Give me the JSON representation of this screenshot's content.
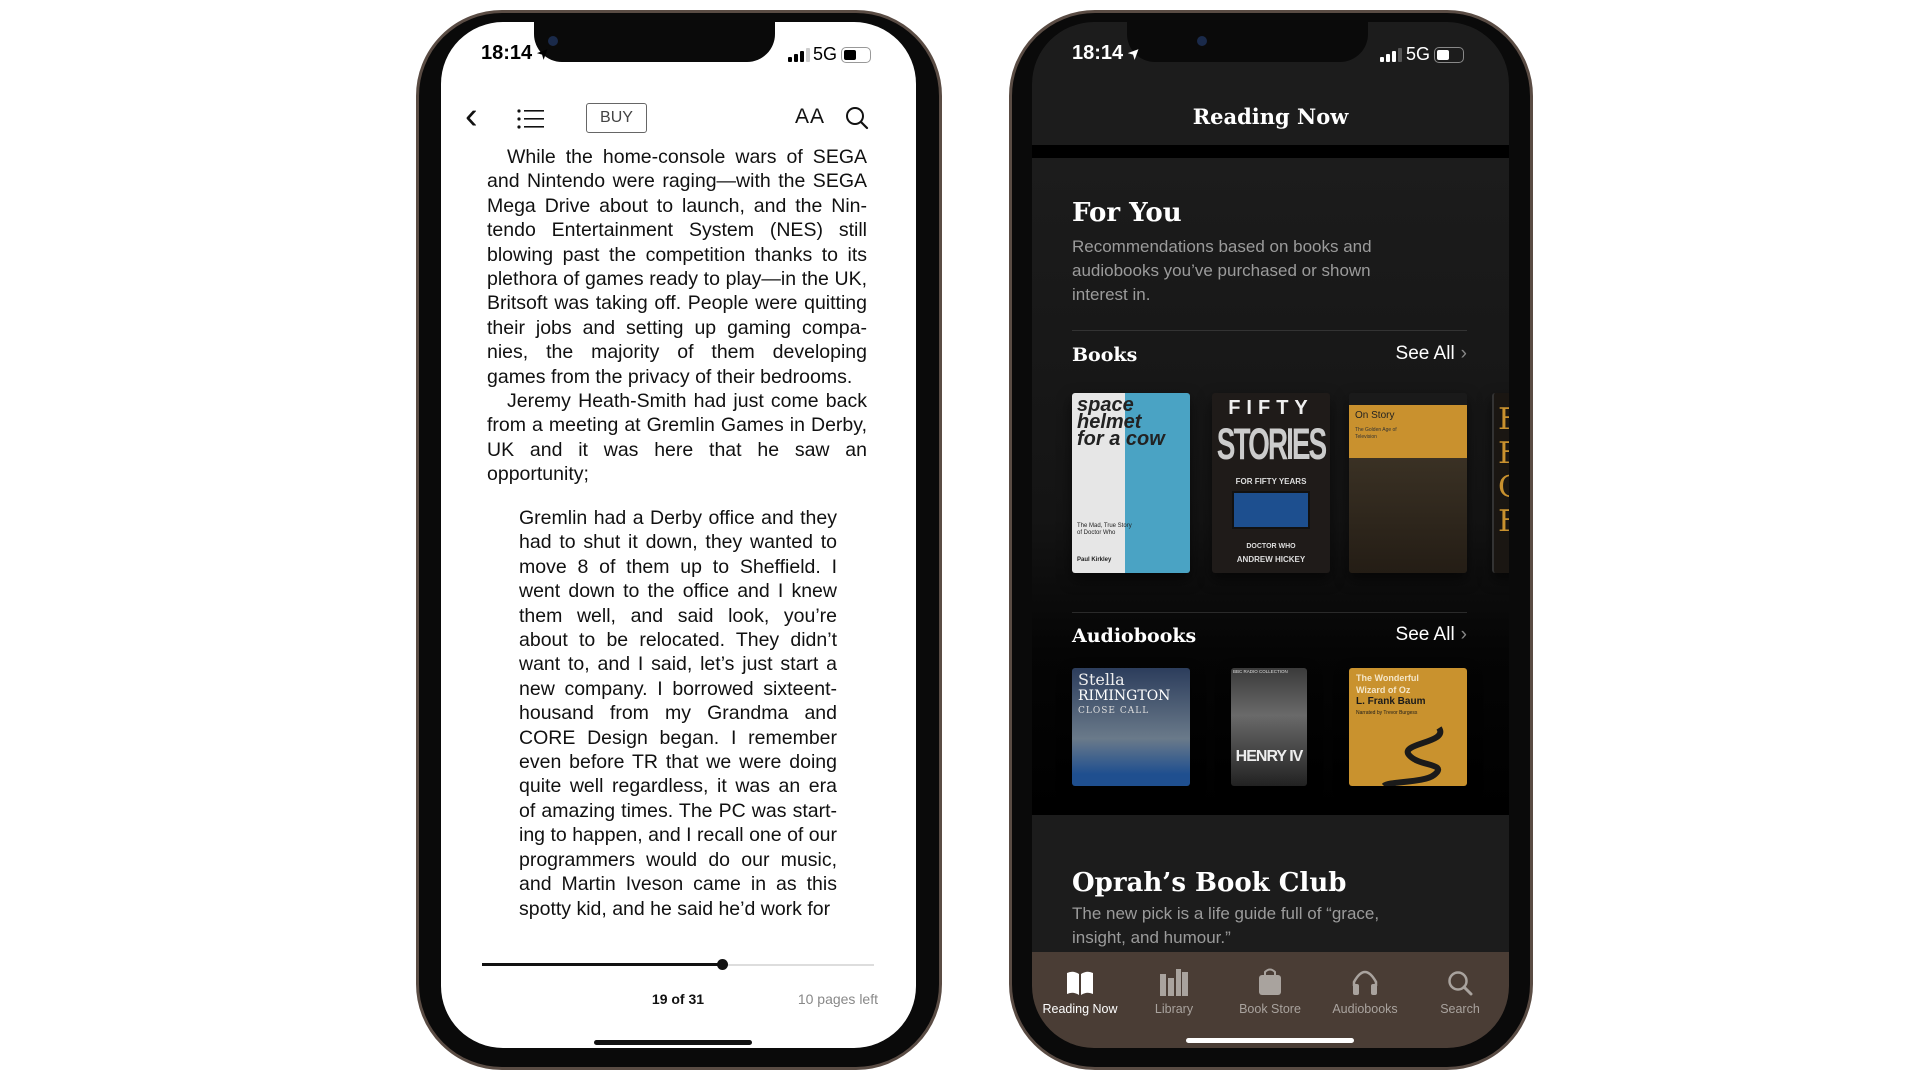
{
  "reader": {
    "status": {
      "time": "18:14",
      "network": "5G"
    },
    "toolbar": {
      "buy_label": "BUY",
      "font_label": "AA"
    },
    "paragraphs": [
      [
        "While the home-console wars of SEGA",
        "and Nintendo were raging—with the SEGA",
        "Mega Drive about to launch, and the Nin-",
        "tendo Entertainment System (NES) still",
        "blowing past the competition thanks to its",
        "plethora of games ready to play—in the UK,",
        "Britsoft was taking off. People were quitting",
        "their jobs and setting up gaming compa-",
        "nies, the majority of them developing",
        "games from the privacy of their bedrooms."
      ],
      [
        "Jeremy Heath-Smith had just come back",
        "from a meeting at Gremlin Games in Derby,",
        "UK and it was here that he saw an",
        "opportunity;"
      ]
    ],
    "quote": [
      "Gremlin had a Derby office and they",
      "had to shut it down, they wanted to",
      "move 8 of them up to Sheffield. I",
      "went down to the office and I knew",
      "them well, and said look, you’re",
      "about to be relocated. They didn’t",
      "want to, and I said, let’s just start a",
      "new company. I borrowed sixteent-",
      "housand from my Grandma and",
      "CORE Design began. I remember",
      "even before TR that we were doing",
      "quite well regardless, it was an era",
      "of amazing times. The PC was start-",
      "ing to happen, and I recall one of our",
      "programmers would do our music,",
      "and Martin Iveson came in as this",
      "spotty kid, and he said he’d work for"
    ],
    "progress": {
      "page_label": "19 of 31",
      "pages_left": "10 pages left",
      "current": 19,
      "total": 31
    }
  },
  "store": {
    "status": {
      "time": "18:14",
      "network": "5G"
    },
    "title": "Reading Now",
    "for_you": {
      "title": "For You",
      "subtitle_lines": [
        "Recommendations based on books and",
        "audiobooks you’ve purchased or shown",
        "interest in."
      ]
    },
    "books": {
      "title": "Books",
      "see_all": "See All",
      "covers": [
        {
          "title": "space helmet for a cow",
          "subtitle": "The Mad, True Story of Doctor Who",
          "author": "Paul Kirkley"
        },
        {
          "title": "FIFTY",
          "title2": "STORIES",
          "subtitle": "FOR FIFTY YEARS",
          "series": "DOCTOR WHO",
          "author": "ANDREW HICKEY"
        },
        {
          "title": "On Story",
          "subtitle": "The Golden Age of Television"
        }
      ]
    },
    "audiobooks": {
      "title": "Audiobooks",
      "see_all": "See All",
      "covers": [
        {
          "author": "Stella",
          "author2": "RIMINGTON",
          "title": "CLOSE CALL"
        },
        {
          "label": "BBC RADIO COLLECTION",
          "title": "HENRY IV"
        },
        {
          "title": "The Wonderful Wizard of Oz",
          "author": "L. Frank Baum",
          "narrator": "Narrated by Trevor Burgess"
        }
      ]
    },
    "oprah": {
      "title": "Oprah’s Book Club",
      "subtitle_lines": [
        "The new pick is a life guide full of “grace,",
        "insight, and humour.”"
      ]
    },
    "tabs": [
      {
        "label": "Reading Now",
        "icon": "book-open-icon",
        "active": true
      },
      {
        "label": "Library",
        "icon": "library-icon"
      },
      {
        "label": "Book Store",
        "icon": "shopping-bag-icon"
      },
      {
        "label": "Audiobooks",
        "icon": "headphones-icon"
      },
      {
        "label": "Search",
        "icon": "search-icon"
      }
    ]
  }
}
